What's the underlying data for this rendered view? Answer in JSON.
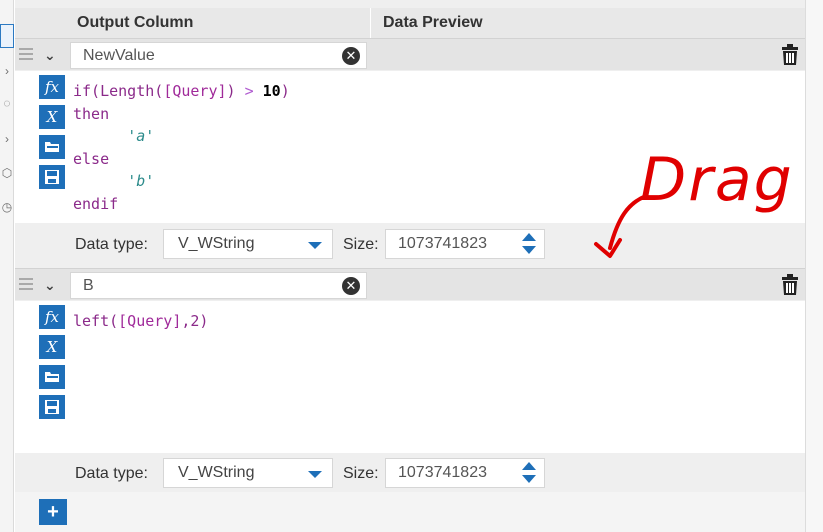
{
  "header": {
    "output_column": "Output Column",
    "data_preview": "Data Preview"
  },
  "rows": [
    {
      "name": "NewValue",
      "code": {
        "l1_fn": "if(Length(",
        "l1_field": "[Query]",
        "l1_close": ")",
        "l1_op": ">",
        "l1_num": "10",
        "l1_end": ")",
        "l2": "then",
        "l3": "'a'",
        "l4": "else",
        "l5": "'b'",
        "l6": "endif"
      },
      "data_type_label": "Data type:",
      "data_type": "V_WString",
      "size_label": "Size:",
      "size": "1073741823"
    },
    {
      "name": "B",
      "code": {
        "l1_fn": "left(",
        "l1_field": "[Query]",
        "l1_rest": ",2)"
      },
      "data_type_label": "Data type:",
      "data_type": "V_WString",
      "size_label": "Size:",
      "size": "1073741823"
    }
  ],
  "tools": {
    "fx": "fx",
    "var": "X"
  },
  "annotation": {
    "text": "Drag"
  },
  "add_label": "+",
  "clear_glyph": "✕",
  "colors": {
    "accent": "#1e6fb8",
    "annotation": "#e00000"
  }
}
